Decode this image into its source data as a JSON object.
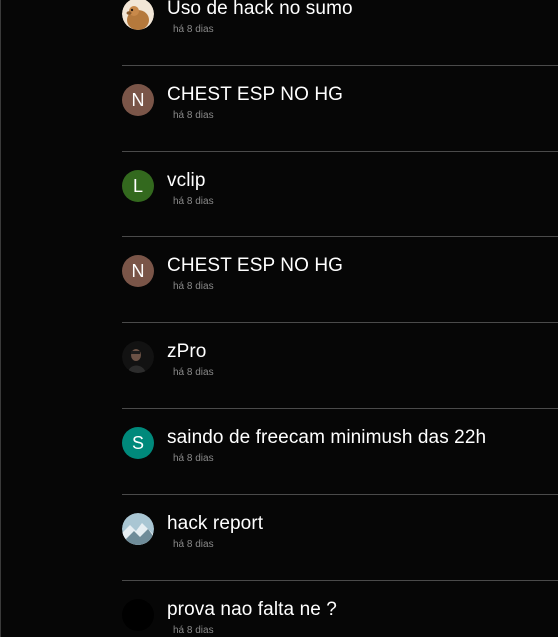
{
  "posts": [
    {
      "title": "Uso de hack no sumo",
      "meta": "há 8 dias",
      "avatar": {
        "letter": "",
        "color": "#b07a3f",
        "kind": "image",
        "icon": "animal-photo-avatar"
      }
    },
    {
      "title": "CHEST ESP NO HG",
      "meta": "há 8 dias",
      "avatar": {
        "letter": "N",
        "color": "#7a5548",
        "kind": "letter",
        "icon": ""
      }
    },
    {
      "title": "vclip",
      "meta": "há 8 dias",
      "avatar": {
        "letter": "L",
        "color": "#33691e",
        "kind": "letter",
        "icon": ""
      }
    },
    {
      "title": "CHEST ESP NO HG",
      "meta": "há 8 dias",
      "avatar": {
        "letter": "N",
        "color": "#7a5548",
        "kind": "letter",
        "icon": ""
      }
    },
    {
      "title": "zPro",
      "meta": "há 8 dias",
      "avatar": {
        "letter": "",
        "color": "#1a1a1a",
        "kind": "image",
        "icon": "person-photo-avatar"
      }
    },
    {
      "title": "saindo de freecam minimush das 22h",
      "meta": "há 8 dias",
      "avatar": {
        "letter": "S",
        "color": "#00897b",
        "kind": "letter",
        "icon": ""
      }
    },
    {
      "title": "hack report",
      "meta": "há 8 dias",
      "avatar": {
        "letter": "",
        "color": "#8fb4c4",
        "kind": "image",
        "icon": "landscape-photo-avatar"
      }
    },
    {
      "title": "prova nao falta ne ?",
      "meta": "há 8 dias",
      "avatar": {
        "letter": "",
        "color": "#000000",
        "kind": "image",
        "icon": "black-avatar"
      }
    }
  ]
}
